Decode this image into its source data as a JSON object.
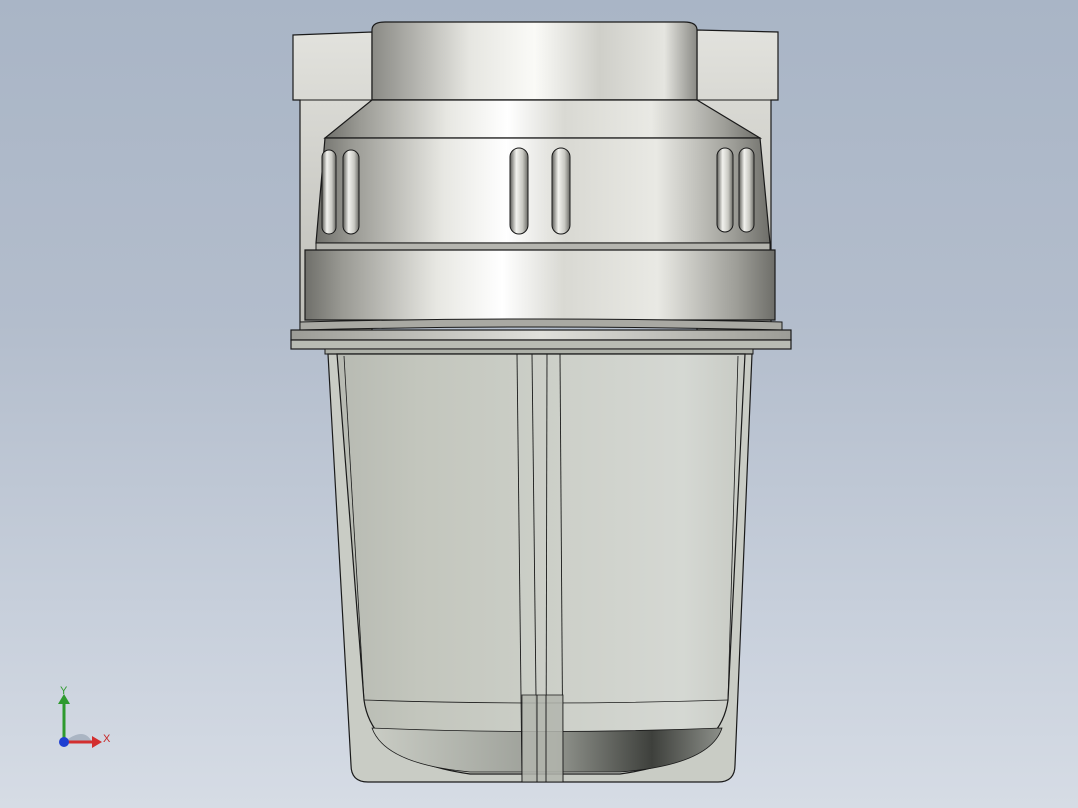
{
  "viewport": {
    "background_top": "#a9b5c6",
    "background_bottom": "#d6dce5"
  },
  "model": {
    "part": "water-filter-housing",
    "cap_color": "#c9c9c2",
    "bowl_color": "#c8cbc4",
    "edge_color": "#1a1a1a"
  },
  "triad": {
    "x_label": "X",
    "y_label": "Y",
    "x_color": "#d32f2f",
    "y_color": "#2e9a2e",
    "z_color": "#1f3fd1"
  }
}
